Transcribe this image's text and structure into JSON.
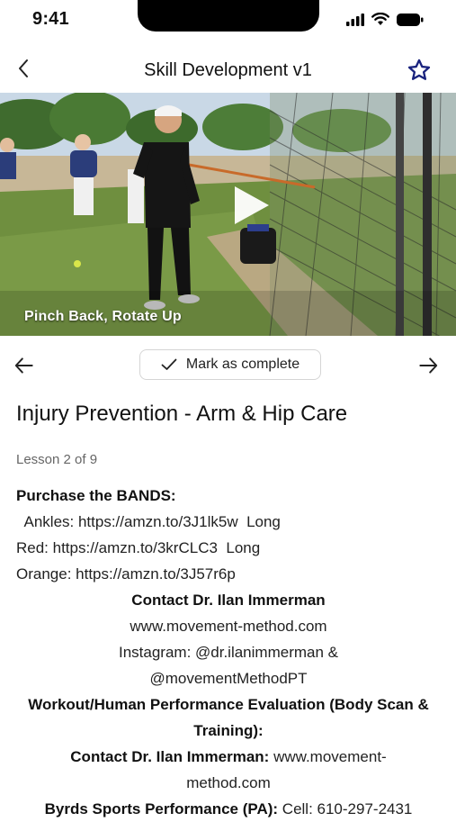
{
  "status_bar": {
    "time": "9:41"
  },
  "nav": {
    "title": "Skill Development v1"
  },
  "video": {
    "caption": "Pinch Back, Rotate Up"
  },
  "controls": {
    "mark_complete_label": "Mark as complete"
  },
  "lesson": {
    "title": "Injury Prevention - Arm & Hip Care",
    "count": "Lesson 2 of 9"
  },
  "description": {
    "purchase_heading": "Purchase the BANDS:",
    "ankles": "  Ankles: https://amzn.to/3J1lk5w  Long",
    "red": "Red: https://amzn.to/3krCLC3  Long",
    "orange": "Orange: https://amzn.to/3J57r6p",
    "contact_heading": "Contact Dr. Ilan Immerman",
    "website": "www.movement-method.com",
    "instagram_1": "Instagram: @dr.ilanimmerman &",
    "instagram_2": "@movementMethodPT",
    "workout_heading": "Workout/Human Performance Evaluation (Body Scan & Training):",
    "contact2_bold": "Contact Dr. Ilan Immerman:",
    "contact2_text": " www.movement-method.com",
    "byrds_bold": "Byrds Sports Performance (PA):",
    "byrds_text": " Cell: 610-297-2431"
  },
  "colors": {
    "star": "#1a237e",
    "text": "#111111",
    "muted": "#666666",
    "border": "#d5d5d5"
  },
  "icons": [
    "back-chevron-icon",
    "star-outline-icon",
    "play-icon",
    "arrow-left-icon",
    "checkmark-icon",
    "arrow-right-icon",
    "signal-icon",
    "wifi-icon",
    "battery-icon"
  ]
}
